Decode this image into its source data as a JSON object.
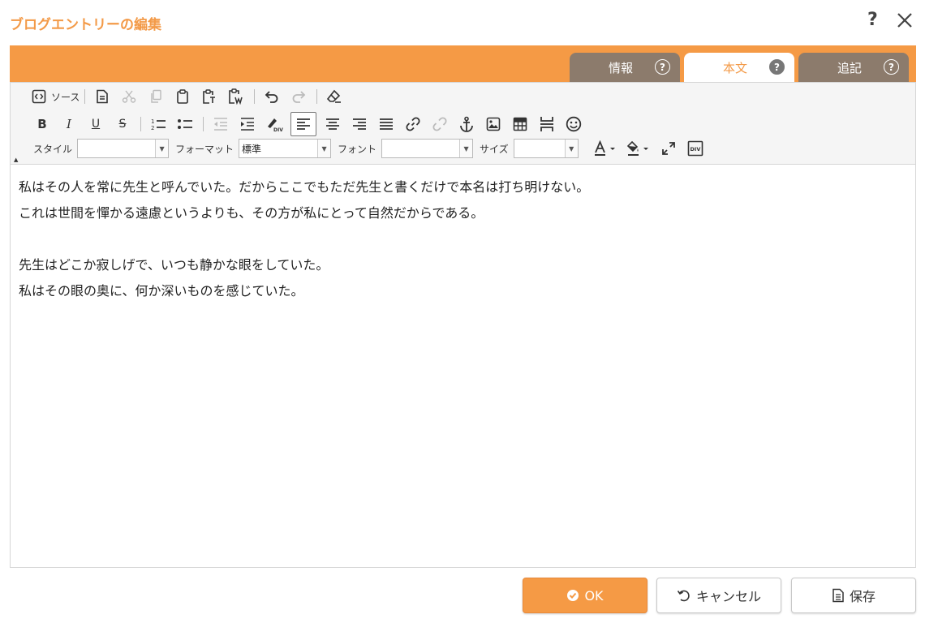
{
  "dialog": {
    "title": "ブログエントリーの編集",
    "help": "?",
    "accent_color": "#f59a45"
  },
  "tabs": [
    {
      "label": "情報",
      "active": false
    },
    {
      "label": "本文",
      "active": true
    },
    {
      "label": "追記",
      "active": false
    }
  ],
  "toolbar": {
    "source_label": "ソース",
    "style_label": "スタイル",
    "style_value": "",
    "format_label": "フォーマット",
    "format_value": "標準",
    "font_label": "フォント",
    "font_value": "",
    "size_label": "サイズ",
    "size_value": ""
  },
  "content": {
    "paragraphs": [
      "私はその人を常に先生と呼んでいた。だからここでもただ先生と書くだけで本名は打ち明けない。",
      "これは世間を憚かる遠慮というよりも、その方が私にとって自然だからである。",
      "",
      "先生はどこか寂しげで、いつも静かな眼をしていた。",
      "私はその眼の奥に、何か深いものを感じていた。"
    ]
  },
  "footer": {
    "ok_label": "OK",
    "cancel_label": "キャンセル",
    "save_label": "保存"
  }
}
